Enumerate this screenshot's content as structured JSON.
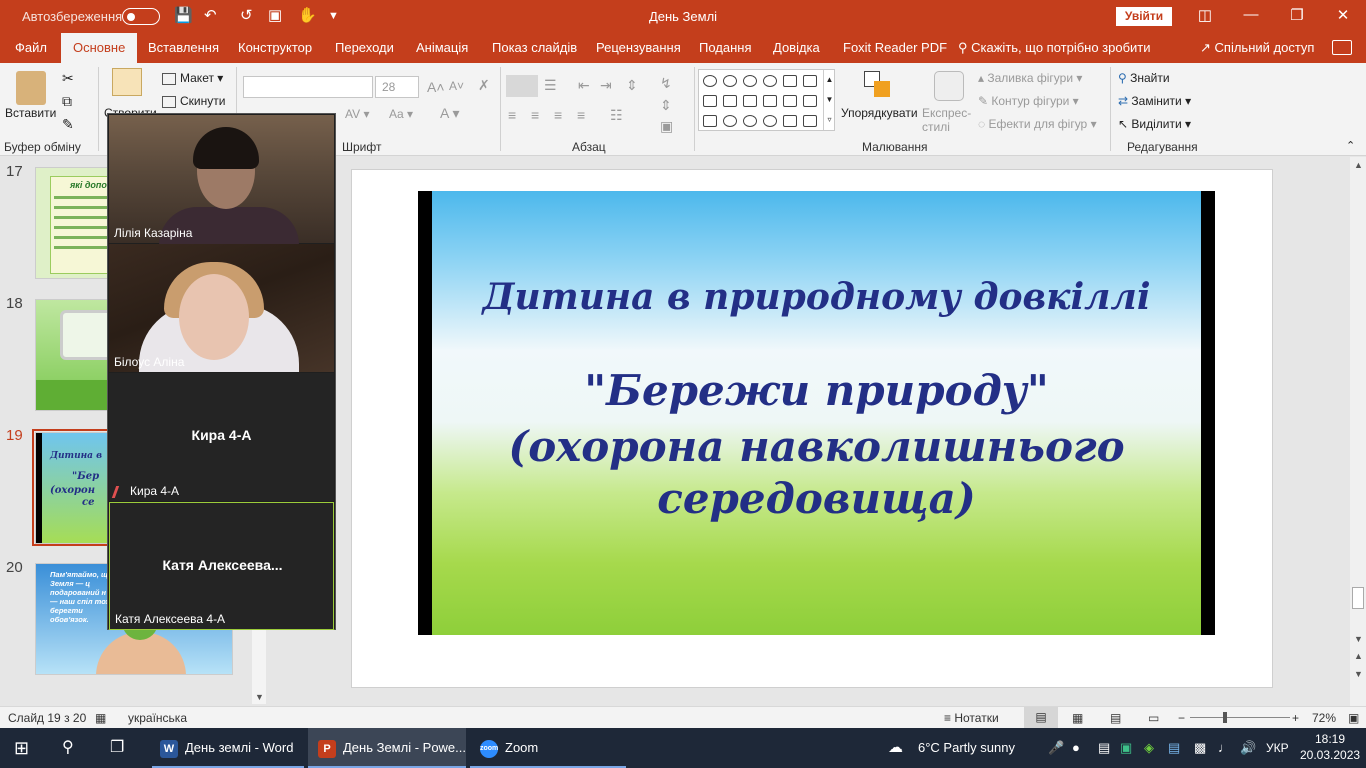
{
  "titlebar": {
    "autosave_label": "Автозбереження",
    "document_title": "День Землі",
    "signin_label": "Увійти"
  },
  "menu": {
    "tabs": [
      "Файл",
      "Основне",
      "Вставлення",
      "Конструктор",
      "Переходи",
      "Анімація",
      "Показ слайдів",
      "Рецензування",
      "Подання",
      "Довідка",
      "Foxit Reader PDF"
    ],
    "tell_me": "Скажіть, що потрібно зробити",
    "share": "Спільний доступ"
  },
  "ribbon": {
    "clipboard": {
      "paste": "Вставити",
      "group": "Буфер обміну"
    },
    "slides": {
      "new_slide": "Створити",
      "layout": "Макет",
      "reset": "Скинути"
    },
    "font": {
      "group": "Шрифт",
      "size_value": "28"
    },
    "paragraph": {
      "group": "Абзац"
    },
    "drawing": {
      "group": "Малювання",
      "arrange": "Упорядкувати",
      "quick_styles": "Експрес-стилі",
      "fill": "Заливка фігури",
      "outline": "Контур фігури",
      "effects": "Ефекти для фігур"
    },
    "editing": {
      "group": "Редагування",
      "find": "Знайти",
      "replace": "Замінити",
      "select": "Виділити"
    }
  },
  "thumbnails": {
    "numbers": [
      "17",
      "18",
      "19",
      "20"
    ],
    "current": "19",
    "snippets": {
      "t17": "які допом",
      "t19_line1": "Дитина в",
      "t19_line2": "\"Бер",
      "t19_line3": "(охорон",
      "t19_line4": "се",
      "t20": "Пам'ятаймо, що Земля — ц подарований н це — наш спіл тож берегти обов'язок."
    }
  },
  "slide": {
    "line1": "Дитина в природному довкіллі",
    "line2": "\"Бережи природу\"",
    "line3": "(охорона навколишнього",
    "line4": "середовища)"
  },
  "zoom": {
    "participants": [
      {
        "name": "Лілія Казаріна",
        "video": true
      },
      {
        "name": "Білоус Аліна",
        "video": true
      },
      {
        "name": "Кира 4-А",
        "display": "Кира 4-А",
        "video": false,
        "muted": true
      },
      {
        "name": "Катя Алексеева 4-А",
        "display": "Катя Алексеева...",
        "video": false,
        "active_speaker": true
      }
    ]
  },
  "statusbar": {
    "slide_counter": "Слайд 19 з 20",
    "language": "українська",
    "notes": "Нотатки",
    "zoom_level": "72%"
  },
  "taskbar": {
    "apps": [
      {
        "label": "День землі - Word",
        "icon": "W",
        "color": "#2b579a"
      },
      {
        "label": "День Землі - Powe...",
        "icon": "P",
        "color": "#c43e1c",
        "active": true
      },
      {
        "label": "Zoom",
        "icon": "zoom",
        "color": "#2d8cff"
      }
    ],
    "weather": "6°C  Partly sunny",
    "lang": "УКР",
    "time": "18:19",
    "date": "20.03.2023"
  }
}
